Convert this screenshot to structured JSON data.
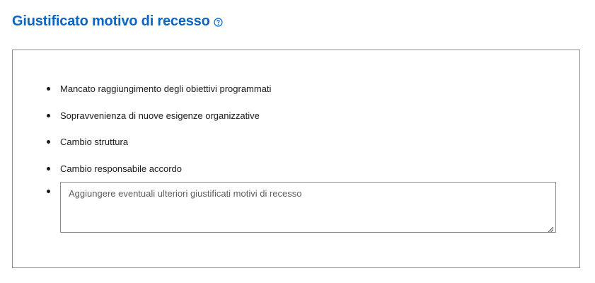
{
  "section": {
    "title": "Giustificato motivo di recesso",
    "help_icon": "question-circle-icon",
    "accent_color": "#0a66c2"
  },
  "reasons": [
    {
      "label": "Mancato raggiungimento degli obiettivi programmati"
    },
    {
      "label": "Sopravvenienza di nuove esigenze organizzative"
    },
    {
      "label": "Cambio struttura"
    },
    {
      "label": "Cambio responsabile accordo"
    }
  ],
  "extra_reason": {
    "placeholder": "Aggiungere eventuali ulteriori giustificati motivi di recesso",
    "value": ""
  }
}
